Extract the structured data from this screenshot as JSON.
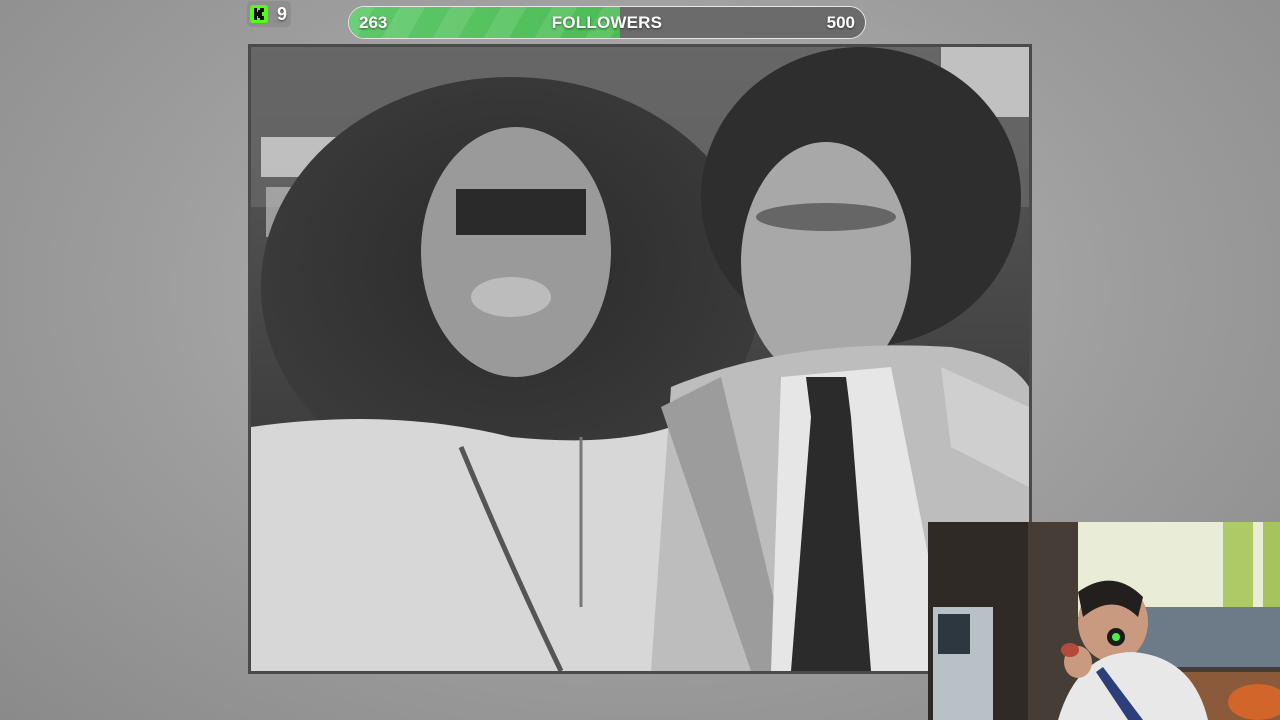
{
  "kick": {
    "logo_icon": "kick-logo-icon",
    "logo_letter": "K",
    "viewer_count": "9",
    "accent_color": "#53fc18"
  },
  "goal": {
    "current": "263",
    "label": "FOLLOWERS",
    "target": "500",
    "progress": 0.526,
    "fill_color": "#4cbc55",
    "track_color": "#6b6b6b"
  },
  "photo": {
    "description_icon": "black-and-white-photo",
    "censor_color": "#2a2a2a"
  },
  "webcam": {
    "icon": "webcam-feed"
  }
}
